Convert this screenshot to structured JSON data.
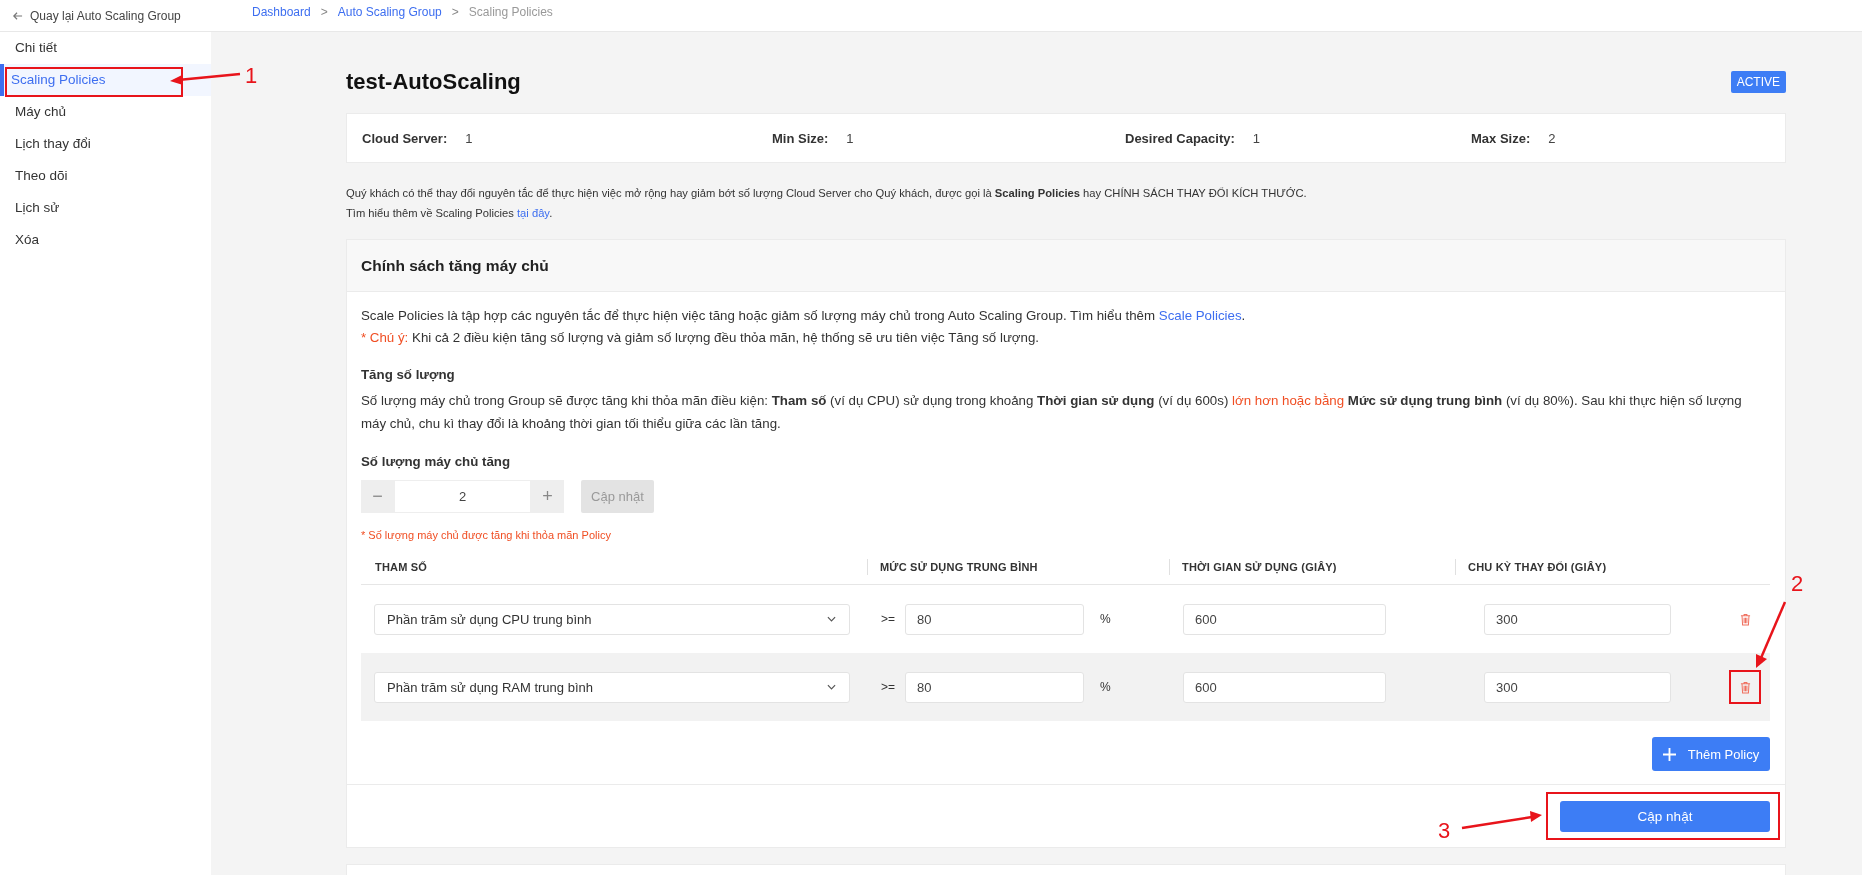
{
  "sidebar": {
    "back_link": "Quay lại Auto Scaling Group",
    "items": [
      {
        "label": "Chi tiết",
        "selected": false
      },
      {
        "label": "Scaling Policies",
        "selected": true,
        "callout": "1"
      },
      {
        "label": "Máy chủ",
        "selected": false
      },
      {
        "label": "Lịch thay đổi",
        "selected": false
      },
      {
        "label": "Theo dõi",
        "selected": false
      },
      {
        "label": "Lịch sử",
        "selected": false
      },
      {
        "label": "Xóa",
        "selected": false
      }
    ]
  },
  "breadcrumb": [
    {
      "label": "Dashboard",
      "current": false
    },
    {
      "label": "Auto Scaling Group",
      "current": false
    },
    {
      "label": "Scaling Policies",
      "current": true
    }
  ],
  "breadcrumb_separator": ">",
  "page": {
    "title": "test-AutoScaling",
    "status": "ACTIVE"
  },
  "stats": [
    {
      "label": "Cloud Server:",
      "value": "1"
    },
    {
      "label": "Min Size:",
      "value": "1"
    },
    {
      "label": "Desired Capacity:",
      "value": "1"
    },
    {
      "label": "Max Size:",
      "value": "2"
    }
  ],
  "intro": [
    [
      {
        "kind": "text",
        "text": "Quý khách có thể thay đổi nguyên tắc để thực hiện việc mở rộng hay giảm bớt số lượng Cloud Server cho Quý khách, được gọi là "
      },
      {
        "kind": "bold",
        "text": "Scaling Policies"
      },
      {
        "kind": "text",
        "text": " hay CHÍNH SÁCH THAY ĐỔI KÍCH THƯỚC."
      }
    ],
    [
      {
        "kind": "text",
        "text": "Tìm hiểu thêm về Scaling Policies "
      },
      {
        "kind": "link",
        "text": "tại đây"
      },
      {
        "kind": "text",
        "text": "."
      }
    ]
  ],
  "policy_card": {
    "title": "Chính sách tăng máy chủ",
    "notes": [
      [
        {
          "kind": "text",
          "text": "Scale Policies là tập hợp các nguyên tắc để thực hiện việc tăng hoặc giảm số lượng máy chủ trong Auto Scaling Group. Tìm hiểu thêm "
        },
        {
          "kind": "link",
          "text": "Scale Policies"
        },
        {
          "kind": "text",
          "text": "."
        }
      ],
      [
        {
          "kind": "red",
          "text": "* Chú ý:"
        },
        {
          "kind": "text",
          "text": " Khi cả 2 điều kiện tăng số lượng và giảm số lượng đều thỏa mãn, hệ thống sẽ ưu tiên việc Tăng số lượng."
        }
      ]
    ],
    "section_title": "Tăng số lượng",
    "section_text": [
      {
        "kind": "text",
        "text": "Số lượng máy chủ trong Group sẽ được tăng khi thỏa mãn điều kiện: "
      },
      {
        "kind": "bold",
        "text": "Tham số"
      },
      {
        "kind": "text",
        "text": " (ví dụ CPU) sử dụng trong khoảng "
      },
      {
        "kind": "bold",
        "text": "Thời gian sử dụng"
      },
      {
        "kind": "text",
        "text": " (ví dụ 600s) "
      },
      {
        "kind": "red",
        "text": "lớn hơn hoặc bằng"
      },
      {
        "kind": "bold",
        "text": " Mức sử dụng trung bình"
      },
      {
        "kind": "text",
        "text": " (ví dụ 80%). Sau khi thực hiện số lượng máy chủ, chu kì thay đổi là khoảng thời gian tối thiểu giữa các lần tăng."
      }
    ],
    "stepper": {
      "label": "Số lượng máy chủ tăng",
      "minus": "−",
      "value": "2",
      "plus": "+",
      "button": "Cập nhật",
      "button_disabled": true
    },
    "stepper_note": "* Số lượng máy chủ được tăng khi thỏa mãn Policy",
    "columns": [
      "THAM SỐ",
      "MỨC SỬ DỤNG TRUNG BÌNH",
      "THỜI GIAN SỬ DỤNG (GIÂY)",
      "CHU KỲ THAY ĐỔI (GIÂY)"
    ],
    "rows": [
      {
        "metric": "Phần trăm sử dụng CPU trung bình",
        "operator": ">=",
        "threshold": "80",
        "unit": "%",
        "duration": "600",
        "cooldown": "300",
        "hovered": false
      },
      {
        "metric": "Phần trăm sử dụng RAM trung bình",
        "operator": ">=",
        "threshold": "80",
        "unit": "%",
        "duration": "600",
        "cooldown": "300",
        "hovered": true,
        "callout": "2"
      }
    ],
    "add_button": "Thêm Policy",
    "save_button": {
      "label": "Cập nhật",
      "callout": "3"
    }
  }
}
